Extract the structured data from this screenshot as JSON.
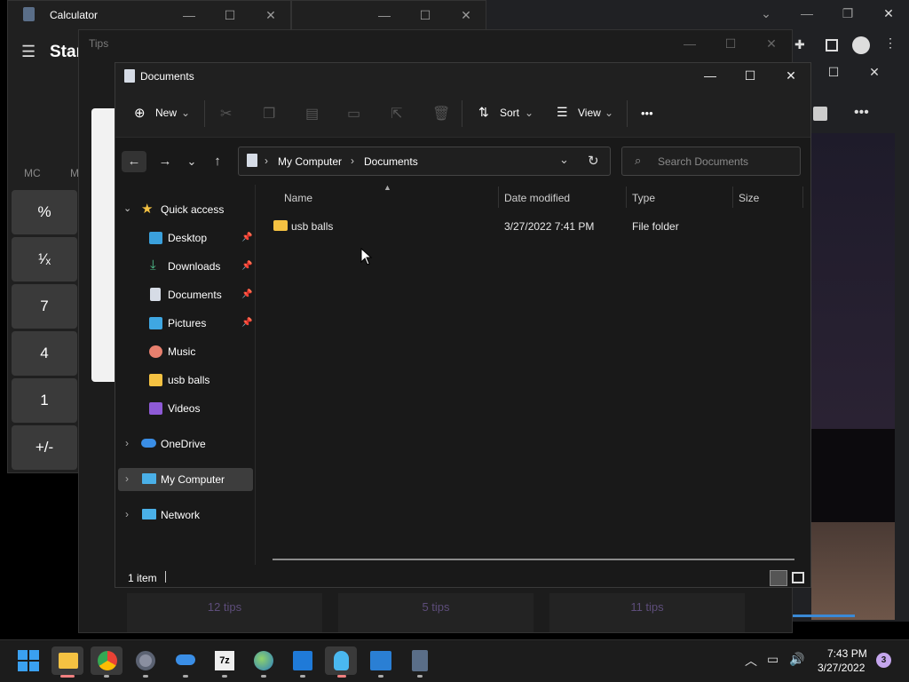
{
  "calculator": {
    "title": "Calculator",
    "mode": "Star",
    "memory": [
      "MC",
      "M"
    ],
    "buttons": [
      "%",
      "¹⁄ₓ",
      "7",
      "4",
      "1",
      "+/-"
    ]
  },
  "tips": {
    "title": "Tips",
    "counts": [
      "12 tips",
      "5 tips",
      "11 tips"
    ]
  },
  "explorer": {
    "title": "Documents",
    "toolbar": {
      "new": "New",
      "sort": "Sort",
      "view": "View",
      "more": "•••"
    },
    "address": {
      "crumbs": [
        "My Computer",
        "Documents"
      ],
      "separator": "›"
    },
    "search": {
      "placeholder": "Search Documents"
    },
    "sidebar": {
      "quick_access": "Quick access",
      "items": [
        {
          "label": "Desktop",
          "pinned": true
        },
        {
          "label": "Downloads",
          "pinned": true
        },
        {
          "label": "Documents",
          "pinned": true
        },
        {
          "label": "Pictures",
          "pinned": true
        },
        {
          "label": "Music",
          "pinned": false
        },
        {
          "label": "usb balls",
          "pinned": false
        },
        {
          "label": "Videos",
          "pinned": false
        }
      ],
      "onedrive": "OneDrive",
      "my_computer": "My Computer",
      "network": "Network"
    },
    "columns": {
      "name": "Name",
      "date": "Date modified",
      "type": "Type",
      "size": "Size"
    },
    "files": [
      {
        "name": "usb balls",
        "date": "3/27/2022 7:41 PM",
        "type": "File folder",
        "size": ""
      }
    ],
    "status": "1 item"
  },
  "taskbar": {
    "time": "7:43 PM",
    "date": "3/27/2022",
    "notifications": "3",
    "apps": [
      "start-icon",
      "file-explorer-icon",
      "chrome-icon",
      "settings-icon",
      "onedrive-app-icon",
      "7zip-icon",
      "earth-icon",
      "calendar-icon",
      "tips-icon",
      "media-icon",
      "calculator-icon"
    ]
  }
}
